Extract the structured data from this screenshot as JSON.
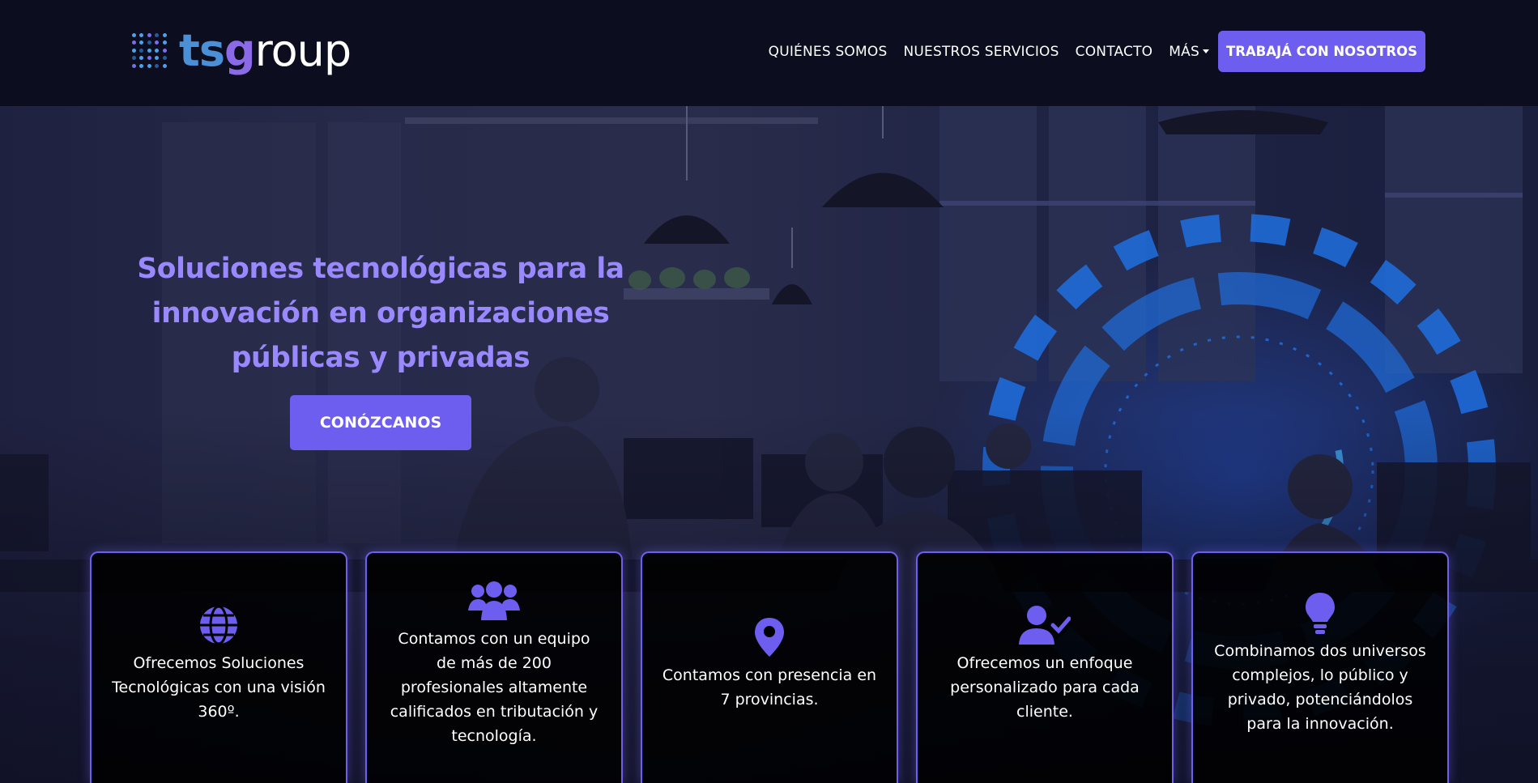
{
  "brand": {
    "name_part1": "ts",
    "name_part2": "g",
    "name_part3": "roup"
  },
  "nav": {
    "items": [
      "QUIÉNES SOMOS",
      "NUESTROS SERVICIOS",
      "CONTACTO",
      "MÁS"
    ],
    "cta": "TRABAJÁ CON NOSOTROS"
  },
  "hero": {
    "headline": "Soluciones tecnológicas para la innovación en organizaciones públicas y privadas",
    "cta": "CONÓZCANOS"
  },
  "features": [
    {
      "icon": "globe-icon",
      "text": "Ofrecemos Soluciones Tecnológicas con una visión 360º."
    },
    {
      "icon": "users-icon",
      "text": "Contamos con un equipo de más de 200 profesionales altamente calificados en tributación y tecnología."
    },
    {
      "icon": "map-pin-icon",
      "text": "Contamos con presencia en 7 provincias."
    },
    {
      "icon": "user-check-icon",
      "text": "Ofrecemos un enfoque personalizado para cada cliente."
    },
    {
      "icon": "lightbulb-icon",
      "text": "Combinamos dos universos complejos, lo público y privado, potenciándolos para la innovación."
    }
  ],
  "colors": {
    "accent": "#6d5ef0",
    "headline": "#9a88ff",
    "background": "#0c0d1f"
  }
}
